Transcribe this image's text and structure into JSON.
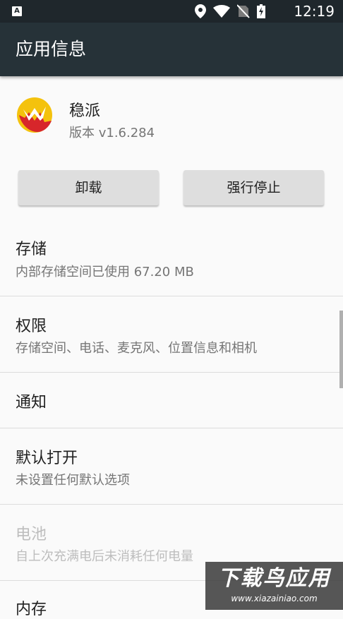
{
  "status_bar": {
    "time": "12:19",
    "icons": [
      "notification-a-icon",
      "location-icon",
      "wifi-icon",
      "no-sim-icon",
      "battery-charging-icon"
    ]
  },
  "app_bar": {
    "title": "应用信息"
  },
  "app": {
    "name": "稳派",
    "version": "版本 v1.6.284"
  },
  "buttons": {
    "uninstall": "卸载",
    "force_stop": "强行停止"
  },
  "rows": [
    {
      "title": "存储",
      "sub": "内部存储空间已使用 67.20 MB"
    },
    {
      "title": "权限",
      "sub": "存储空间、电话、麦克风、位置信息和相机"
    },
    {
      "title": "通知"
    },
    {
      "title": "默认打开",
      "sub": "未设置任何默认选项"
    },
    {
      "title": "电池",
      "sub": "自上次充满电后未消耗任何电量"
    },
    {
      "title": "内存"
    }
  ],
  "watermark": {
    "main": "下载鸟应用",
    "sub": "www.xiazainiao.com"
  },
  "colors": {
    "status_bar": "#1f272c",
    "app_bar": "#263238",
    "logo_yellow": "#f4c20d",
    "logo_red": "#d7262b"
  }
}
